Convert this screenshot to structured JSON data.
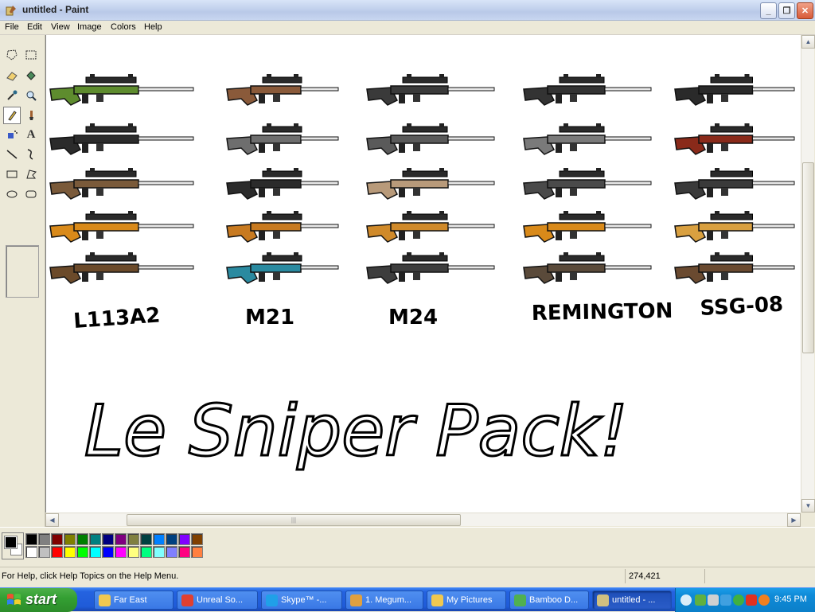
{
  "window": {
    "title": "untitled - Paint"
  },
  "menu": [
    "File",
    "Edit",
    "View",
    "Image",
    "Colors",
    "Help"
  ],
  "toolbox": {
    "tools": [
      "free-form-select",
      "select",
      "eraser",
      "fill",
      "pick-color",
      "magnifier",
      "pencil",
      "brush",
      "airbrush",
      "text",
      "line",
      "curve",
      "rectangle",
      "polygon",
      "ellipse",
      "rounded-rectangle"
    ],
    "selected": "pencil"
  },
  "canvas": {
    "groups": [
      {
        "label": "L113A2",
        "colors": [
          "#5e8c2e",
          "#2b2b2b",
          "#7a5a3a",
          "#d98a1a",
          "#6b4a2a"
        ]
      },
      {
        "label": "M21",
        "colors": [
          "#8a5a3a",
          "#6e6e6e",
          "#2b2b2b",
          "#c87a20",
          "#2a8aa0"
        ]
      },
      {
        "label": "M24",
        "colors": [
          "#3a3a3a",
          "#5a5a5a",
          "#b89a7a",
          "#d08a2a",
          "#3d3d3d"
        ]
      },
      {
        "label": "REMINGTON",
        "colors": [
          "#333333",
          "#7a7a7a",
          "#4a4a4a",
          "#d98a1a",
          "#5a4a3a"
        ]
      },
      {
        "label": "SSG-08",
        "colors": [
          "#2a2a2a",
          "#8a2a1a",
          "#3a3a3a",
          "#d9a040",
          "#6a4a30"
        ]
      }
    ],
    "handwritten_title": "Le Sniper Pack!"
  },
  "palette": {
    "foreground": "#000000",
    "background": "#ffffff",
    "row1": [
      "#000000",
      "#808080",
      "#800000",
      "#808000",
      "#008000",
      "#008080",
      "#000080",
      "#800080",
      "#808040",
      "#004040",
      "#0080ff",
      "#004080",
      "#8000ff",
      "#804000"
    ],
    "row2": [
      "#ffffff",
      "#c0c0c0",
      "#ff0000",
      "#ffff00",
      "#00ff00",
      "#00ffff",
      "#0000ff",
      "#ff00ff",
      "#ffff80",
      "#00ff80",
      "#80ffff",
      "#8080ff",
      "#ff0080",
      "#ff8040"
    ]
  },
  "status": {
    "help_text": "For Help, click Help Topics on the Help Menu.",
    "coords": "274,421"
  },
  "taskbar": {
    "start_label": "start",
    "tasks": [
      {
        "label": "Far East",
        "icon": "folder-icon",
        "color": "#f0c850"
      },
      {
        "label": "Unreal So...",
        "icon": "chrome-icon",
        "color": "#e04030"
      },
      {
        "label": "Skype™ -...",
        "icon": "skype-icon",
        "color": "#20a0e8"
      },
      {
        "label": "1. Megum...",
        "icon": "player-icon",
        "color": "#e0a040"
      },
      {
        "label": "My Pictures",
        "icon": "folder-pictures-icon",
        "color": "#f0c850"
      },
      {
        "label": "Bamboo D...",
        "icon": "bamboo-icon",
        "color": "#50b050"
      },
      {
        "label": "untitled - ...",
        "icon": "paint-icon",
        "color": "#d0c080"
      }
    ],
    "clock": "9:45 PM"
  }
}
